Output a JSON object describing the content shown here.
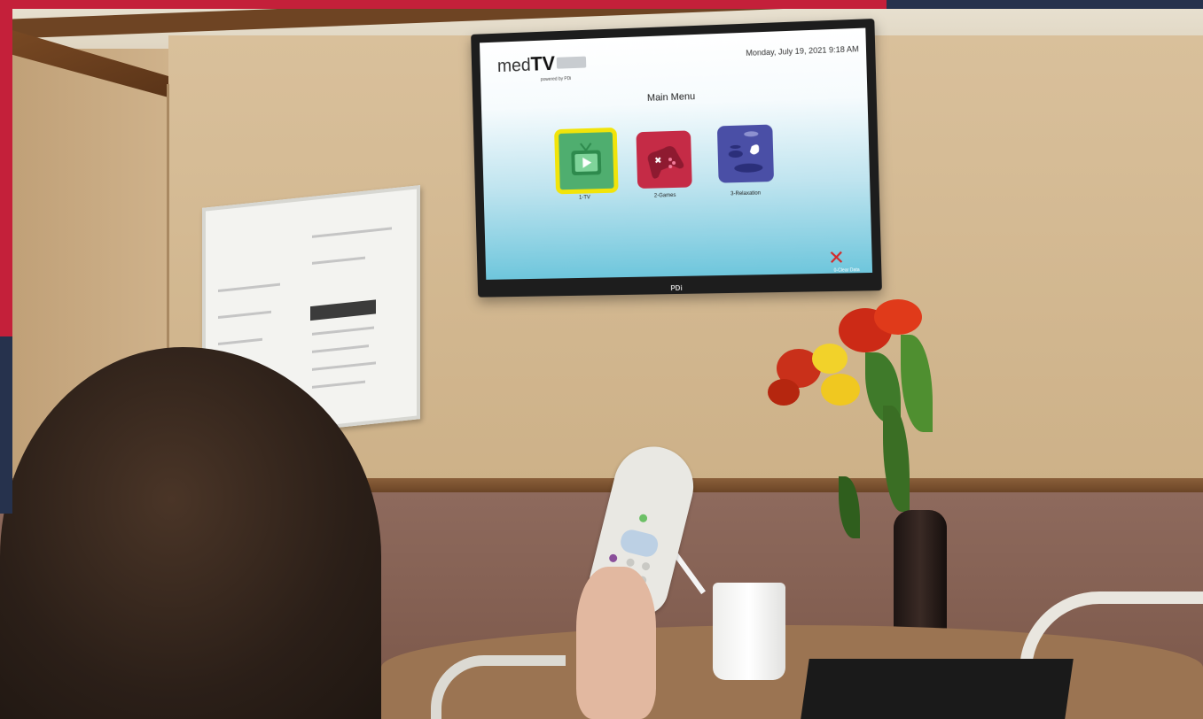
{
  "tv": {
    "brand": "PDi",
    "logo": {
      "prefix": "med",
      "bold": "TV",
      "subtitle": "powered by PDi"
    },
    "datetime": "Monday, July 19, 2021 9:18 AM",
    "title": "Main Menu",
    "menu_items": [
      {
        "label": "1-TV",
        "icon": "tv-icon",
        "color": "#4fae6f",
        "selected": true
      },
      {
        "label": "2-Games",
        "icon": "gamepad-icon",
        "color": "#c52b46",
        "selected": false
      },
      {
        "label": "3-Relaxation",
        "icon": "relaxation-icon",
        "color": "#4a4fa6",
        "selected": false
      }
    ],
    "close": {
      "icon": "close-icon",
      "label": "0-Clear Data"
    }
  },
  "colors": {
    "selection": "#f1e40a",
    "screen_top": "#ffffff",
    "screen_bottom": "#6ec6dc",
    "close": "#d42a2a"
  }
}
